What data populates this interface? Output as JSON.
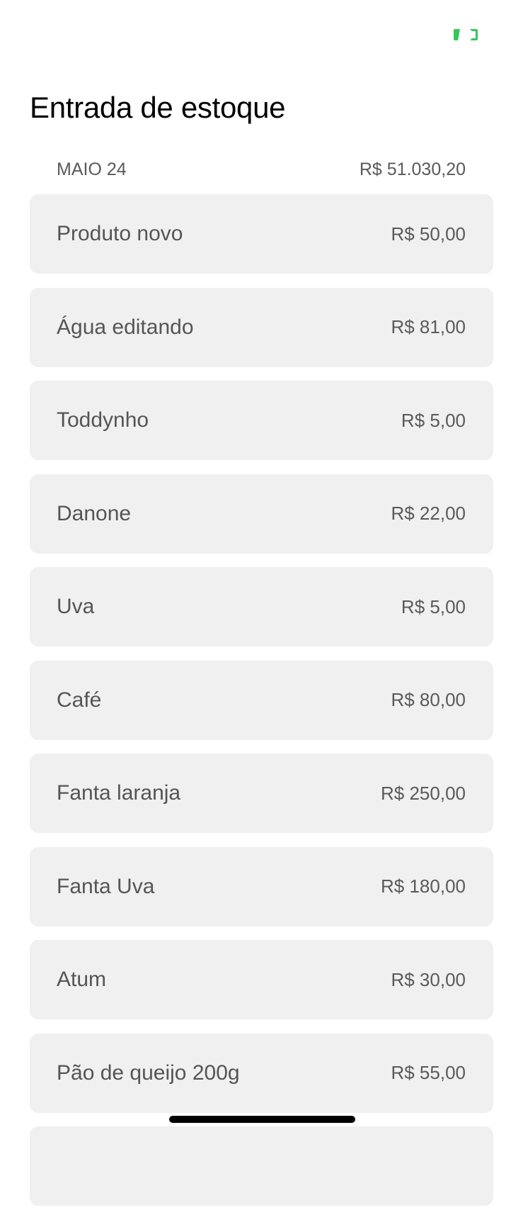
{
  "header": {
    "action_icon": "barcode-scan-icon",
    "accent_color": "#34c759",
    "title": "Entrada de estoque"
  },
  "section": {
    "label": "MAIO 24",
    "total": "R$ 51.030,20"
  },
  "items": [
    {
      "name": "Produto novo",
      "price": "R$ 50,00"
    },
    {
      "name": "Água editando",
      "price": "R$ 81,00"
    },
    {
      "name": "Toddynho",
      "price": "R$ 5,00"
    },
    {
      "name": "Danone",
      "price": "R$ 22,00"
    },
    {
      "name": "Uva",
      "price": "R$ 5,00"
    },
    {
      "name": "Café",
      "price": "R$ 80,00"
    },
    {
      "name": "Fanta laranja",
      "price": "R$ 250,00"
    },
    {
      "name": "Fanta Uva",
      "price": "R$ 180,00"
    },
    {
      "name": "Atum",
      "price": "R$ 30,00"
    },
    {
      "name": "Pão de queijo 200g",
      "price": "R$ 55,00"
    },
    {
      "name": "",
      "price": ""
    }
  ]
}
